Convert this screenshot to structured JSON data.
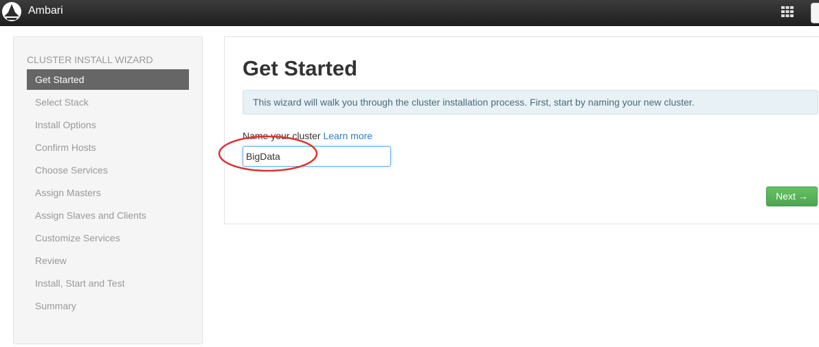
{
  "app": {
    "title": "Ambari"
  },
  "topbar": {
    "logo_icon": "ambari-logo-icon",
    "apps_icon": "grid-icon"
  },
  "sidebar": {
    "header": "CLUSTER INSTALL WIZARD",
    "items": [
      {
        "label": "Get Started",
        "active": true
      },
      {
        "label": "Select Stack",
        "active": false
      },
      {
        "label": "Install Options",
        "active": false
      },
      {
        "label": "Confirm Hosts",
        "active": false
      },
      {
        "label": "Choose Services",
        "active": false
      },
      {
        "label": "Assign Masters",
        "active": false
      },
      {
        "label": "Assign Slaves and Clients",
        "active": false
      },
      {
        "label": "Customize Services",
        "active": false
      },
      {
        "label": "Review",
        "active": false
      },
      {
        "label": "Install, Start and Test",
        "active": false
      },
      {
        "label": "Summary",
        "active": false
      }
    ]
  },
  "main": {
    "title": "Get Started",
    "alert": "This wizard will walk you through the cluster installation process. First, start by naming your new cluster.",
    "field_label": "Name your cluster",
    "learn_more": "Learn more",
    "cluster_name_value": "BigData",
    "next_label": "Next →"
  },
  "colors": {
    "active_nav_bg": "#666666",
    "next_button": "#5bb75b",
    "annotation_circle": "#e03030",
    "link": "#2a7fc1"
  }
}
